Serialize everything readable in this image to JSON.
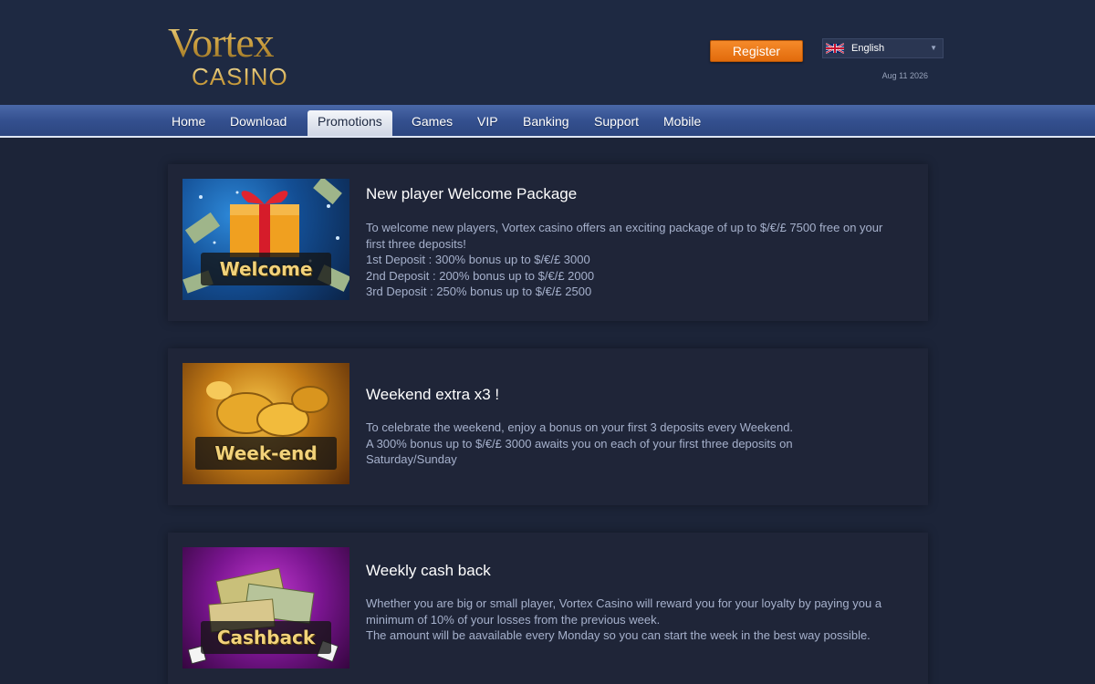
{
  "brand": {
    "logo_line1": "Vortex",
    "logo_line2": "CASINO"
  },
  "header": {
    "register_label": "Register",
    "language": "English",
    "date": "Aug 11 2026"
  },
  "nav": {
    "items": [
      {
        "label": "Home"
      },
      {
        "label": "Download"
      },
      {
        "label": "Promotions",
        "active": true
      },
      {
        "label": "Games"
      },
      {
        "label": "VIP"
      },
      {
        "label": "Banking"
      },
      {
        "label": "Support"
      },
      {
        "label": "Mobile"
      }
    ]
  },
  "promos": [
    {
      "image_label": "Welcome",
      "title": "New player Welcome Package",
      "lines": [
        "To welcome new players, Vortex casino offers an exciting package of up to $/€/£ 7500 free on your first three deposits!",
        "1st Deposit : 300% bonus up to $/€/£ 3000",
        "2nd Deposit : 200% bonus up to $/€/£ 2000",
        "3rd Deposit : 250% bonus up to $/€/£ 2500"
      ]
    },
    {
      "image_label": "Week-end",
      "title": "Weekend extra x3 !",
      "lines": [
        "To celebrate the weekend, enjoy a bonus on your first 3 deposits every Weekend.",
        "A 300% bonus up to $/€/£ 3000 awaits you on each of your first three deposits on Saturday/Sunday"
      ]
    },
    {
      "image_label": "Cashback",
      "title": "Weekly cash back",
      "lines": [
        "Whether you are big or small player, Vortex Casino will reward you for your loyalty by paying you a minimum of 10% of your losses from the previous week.",
        "The amount will be aavailable every Monday so you can start the week in the best way possible."
      ]
    }
  ],
  "colors": {
    "background": "#1c2438",
    "nav": "#34508f",
    "register": "#e87414",
    "card": "#1f2538",
    "desc_text": "#a6b1cc"
  }
}
